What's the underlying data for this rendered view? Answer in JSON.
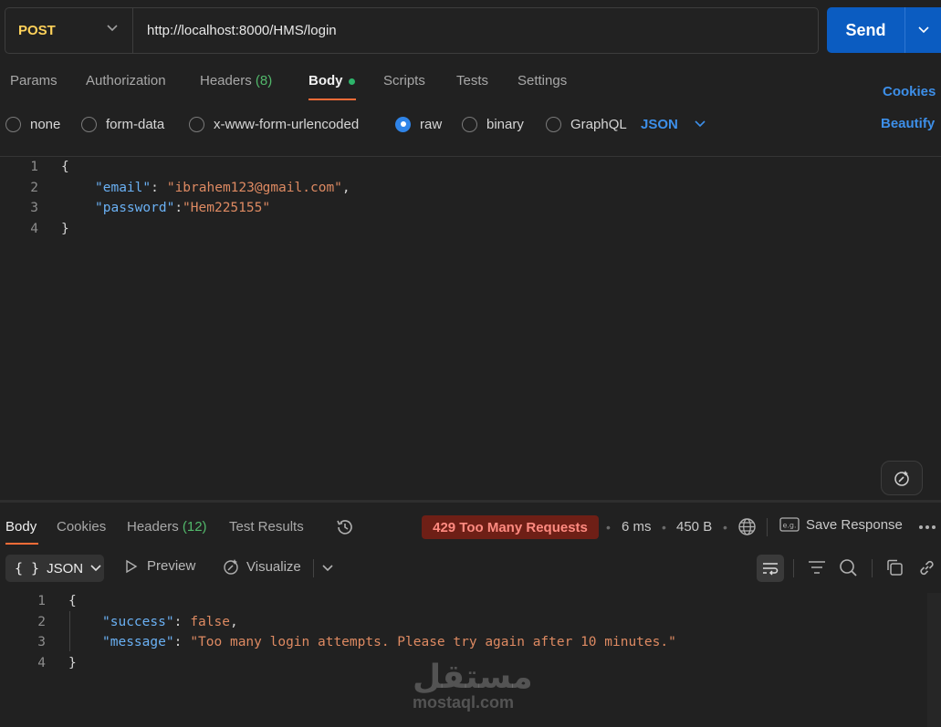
{
  "request": {
    "method": "POST",
    "url": "http://localhost:8000/HMS/login",
    "send_label": "Send"
  },
  "tabs": {
    "params": "Params",
    "authorization": "Authorization",
    "headers": "Headers",
    "headers_count": "(8)",
    "body": "Body",
    "scripts": "Scripts",
    "tests": "Tests",
    "settings": "Settings",
    "cookies": "Cookies"
  },
  "body_types": {
    "none": "none",
    "form_data": "form-data",
    "urlencoded": "x-www-form-urlencoded",
    "raw": "raw",
    "binary": "binary",
    "graphql": "GraphQL",
    "format": "JSON",
    "selected": "raw",
    "beautify": "Beautify"
  },
  "request_body": {
    "line_numbers": [
      "1",
      "2",
      "3",
      "4"
    ],
    "open_brace": "{",
    "close_brace": "}",
    "email_key": "\"email\"",
    "email_value": "\"ibrahem123@gmail.com\"",
    "password_key": "\"password\"",
    "password_value": "\"Hem225155\"",
    "colon": ":",
    "comma": ","
  },
  "response": {
    "tabs": {
      "body": "Body",
      "cookies": "Cookies",
      "headers": "Headers",
      "headers_count": "(12)",
      "test_results": "Test Results"
    },
    "status": "429 Too Many Requests",
    "time": "6 ms",
    "size": "450 B",
    "save_response": "Save Response",
    "format": "JSON",
    "preview": "Preview",
    "visualize": "Visualize",
    "line_numbers": [
      "1",
      "2",
      "3",
      "4"
    ],
    "open_brace": "{",
    "close_brace": "}",
    "success_key": "\"success\"",
    "success_value": "false",
    "message_key": "\"message\"",
    "message_value": "\"Too many login attempts. Please try again after 10 minutes.\"",
    "colon": ":",
    "comma": ","
  },
  "watermark": {
    "arabic": "مستقل",
    "latin": "mostaql.com"
  },
  "colors": {
    "accent_orange": "#ff6c37",
    "send_blue": "#0b5cc1",
    "method_yellow": "#ffd25a",
    "status_red_bg": "#6e1f16",
    "json_key": "#6ab0f3",
    "json_string": "#de8a62"
  }
}
